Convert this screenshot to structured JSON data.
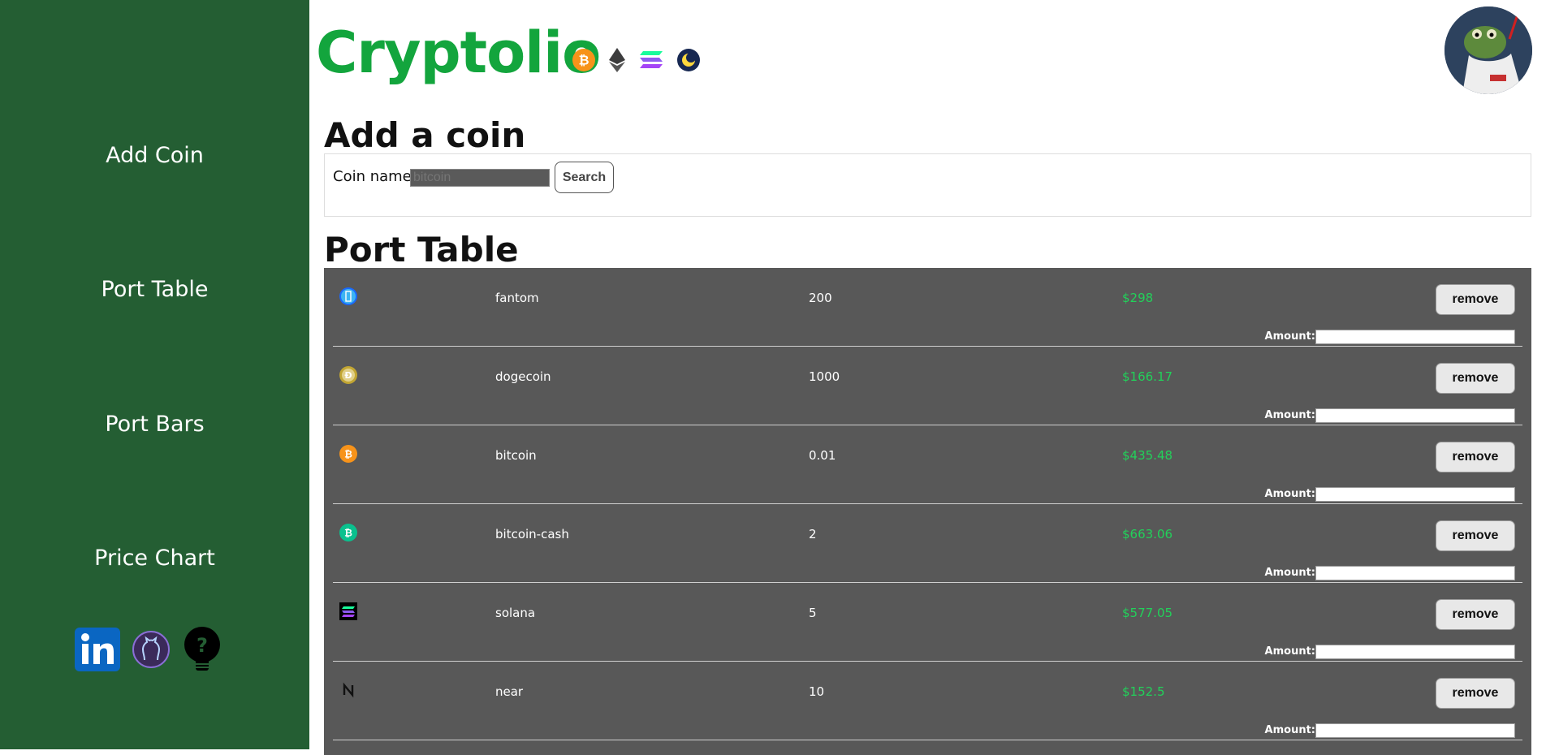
{
  "header": {
    "logo_text": "Cryptolio",
    "logo_coin_icons": [
      "bitcoin-icon",
      "ethereum-icon",
      "solana-icon",
      "terra-luna-icon"
    ]
  },
  "sidebar": {
    "items": [
      {
        "label": "Add Coin"
      },
      {
        "label": "Port Table"
      },
      {
        "label": "Port Bars"
      },
      {
        "label": "Price Chart"
      }
    ],
    "social_icons": [
      "linkedin-icon",
      "github-icon",
      "help-bulb-icon"
    ]
  },
  "add_coin": {
    "title": "Add a coin",
    "field_label": "Coin name:",
    "input_placeholder": "bitcoin",
    "search_label": "Search"
  },
  "port_table": {
    "title": "Port Table",
    "amount_label": "Amount:",
    "remove_label": "remove",
    "rows": [
      {
        "icon": "fantom-icon",
        "name": "fantom",
        "amount": "200",
        "value": "$298"
      },
      {
        "icon": "dogecoin-icon",
        "name": "dogecoin",
        "amount": "1000",
        "value": "$166.17"
      },
      {
        "icon": "bitcoin-icon",
        "name": "bitcoin",
        "amount": "0.01",
        "value": "$435.48"
      },
      {
        "icon": "bitcoin-cash-icon",
        "name": "bitcoin-cash",
        "amount": "2",
        "value": "$663.06"
      },
      {
        "icon": "solana-icon",
        "name": "solana",
        "amount": "5",
        "value": "$577.05"
      },
      {
        "icon": "near-icon",
        "name": "near",
        "amount": "10",
        "value": "$152.5"
      }
    ]
  },
  "colors": {
    "sidebar_bg": "#245e33",
    "logo_green": "#13a53d",
    "table_bg": "#585858",
    "value_green": "#22d15a"
  }
}
